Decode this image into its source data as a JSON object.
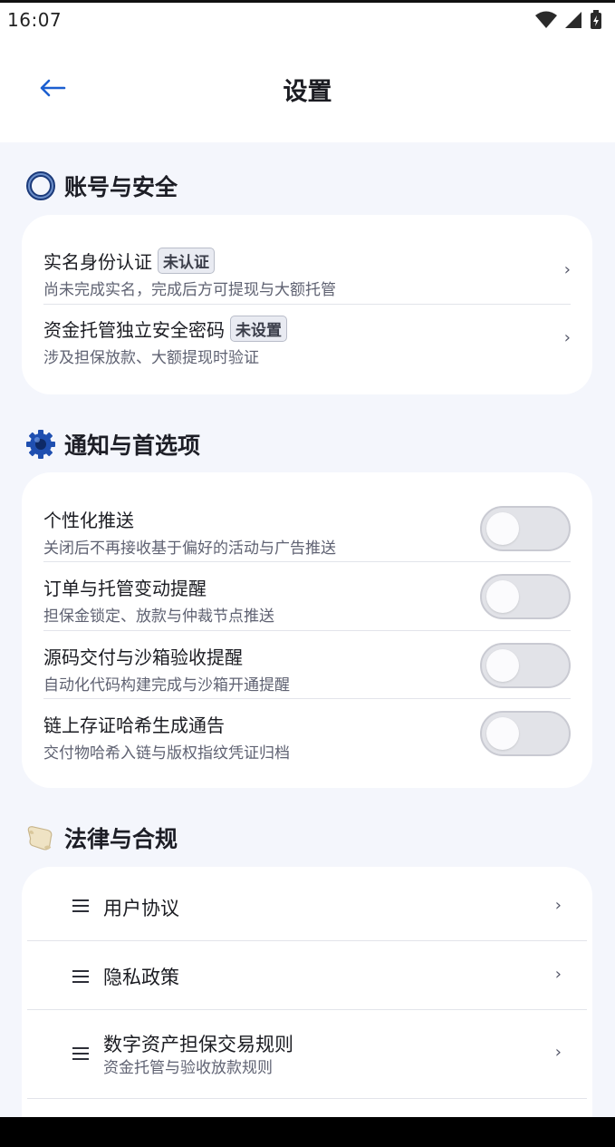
{
  "status_bar": {
    "time": "16:07"
  },
  "header": {
    "title": "设置"
  },
  "sections": {
    "account": {
      "title": "账号与安全",
      "items": [
        {
          "title": "实名身份认证",
          "badge": "未认证",
          "subtitle": "尚未完成实名，完成后方可提现与大额托管"
        },
        {
          "title": "资金托管独立安全密码",
          "badge": "未设置",
          "subtitle": "涉及担保放款、大额提现时验证"
        }
      ]
    },
    "notifications": {
      "title": "通知与首选项",
      "items": [
        {
          "title": "个性化推送",
          "subtitle": "关闭后不再接收基于偏好的活动与广告推送",
          "enabled": false
        },
        {
          "title": "订单与托管变动提醒",
          "subtitle": "担保金锁定、放款与仲裁节点推送",
          "enabled": false
        },
        {
          "title": "源码交付与沙箱验收提醒",
          "subtitle": "自动化代码构建完成与沙箱开通提醒",
          "enabled": false
        },
        {
          "title": "链上存证哈希生成通告",
          "subtitle": "交付物哈希入链与版权指纹凭证归档",
          "enabled": false
        }
      ]
    },
    "legal": {
      "title": "法律与合规",
      "items": [
        {
          "title": "用户协议"
        },
        {
          "title": "隐私政策"
        },
        {
          "title": "数字资产担保交易规则",
          "subtitle": "资金托管与验收放款规则"
        }
      ]
    }
  },
  "colors": {
    "accent": "#1c5fd0",
    "background": "#f4f6fc",
    "card": "#ffffff"
  }
}
